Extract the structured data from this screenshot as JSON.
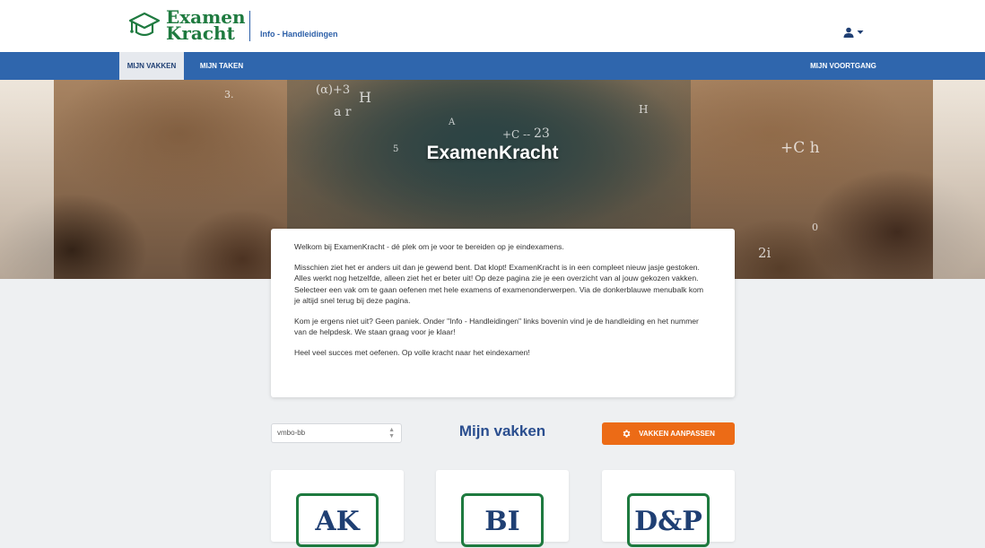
{
  "header": {
    "logo_line1": "Examen",
    "logo_line2": "Kracht",
    "info_link": "Info - Handleidingen",
    "user_icon": "user-icon",
    "user_caret_icon": "caret-down-icon"
  },
  "nav": {
    "items": [
      {
        "label": "MIJN VAKKEN",
        "active": true
      },
      {
        "label": "MIJN TAKEN",
        "active": false
      }
    ],
    "right_item": "MIJN VOORTGANG"
  },
  "hero": {
    "title": "ExamenKracht"
  },
  "welcome": {
    "paragraphs": [
      "Welkom bij ExamenKracht - dé plek om je voor te bereiden op je eindexamens.",
      "Misschien ziet het er anders uit dan je gewend bent. Dat klopt! ExamenKracht is in een compleet nieuw jasje gestoken. Alles werkt nog hetzelfde, alleen ziet het er beter uit! Op deze pagina zie je een overzicht van al jouw gekozen vakken. Selecteer een vak om te gaan oefenen met hele examens of examenonderwerpen. Via de donkerblauwe menubalk kom je altijd snel terug bij deze pagina.",
      "Kom je ergens niet uit? Geen paniek. Onder \"Info - Handleidingen\" links bovenin vind je de handleiding en het nummer van de helpdesk. We staan graag voor je klaar!",
      "Heel veel succes met oefenen. Op volle kracht naar het eindexamen!"
    ]
  },
  "subjects": {
    "level_value": "vmbo-bb",
    "title": "Mijn vakken",
    "adjust_button": "VAKKEN AANPASSEN",
    "adjust_icon": "gear-icon",
    "tiles": [
      {
        "code": "AK"
      },
      {
        "code": "BI"
      },
      {
        "code": "D&P"
      }
    ]
  },
  "colors": {
    "brand_green": "#1e7a3f",
    "nav_blue": "#2f66ad",
    "accent_orange": "#ec6b16",
    "title_blue": "#2a4e8f"
  }
}
